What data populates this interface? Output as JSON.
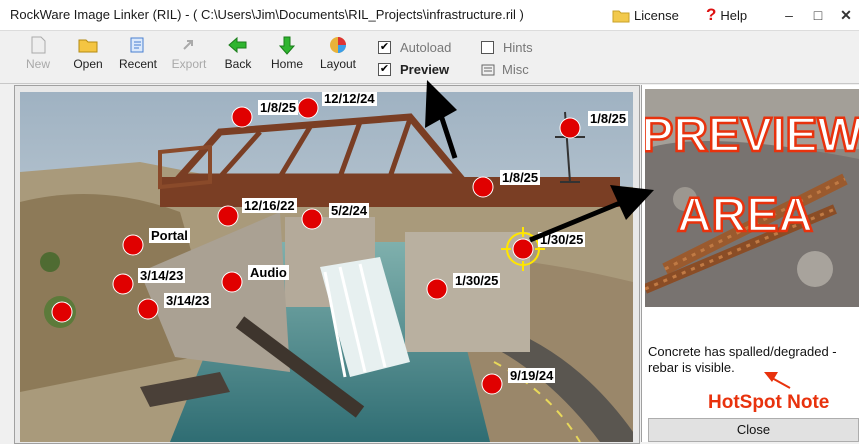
{
  "window": {
    "title": "RockWare Image Linker (RIL) - ( C:\\Users\\Jim\\Documents\\RIL_Projects\\infrastructure.ril )",
    "license_label": "License",
    "help_label": "Help",
    "minimize": "–",
    "maximize": "□",
    "close": "✕"
  },
  "toolbar": {
    "buttons": [
      {
        "label": "New",
        "icon": "new-icon",
        "enabled": false
      },
      {
        "label": "Open",
        "icon": "open-folder-icon",
        "enabled": true
      },
      {
        "label": "Recent",
        "icon": "recent-icon",
        "enabled": true
      },
      {
        "label": "Export",
        "icon": "export-icon",
        "enabled": false
      },
      {
        "label": "Back",
        "icon": "back-arrow-icon",
        "enabled": true
      },
      {
        "label": "Home",
        "icon": "home-arrow-icon",
        "enabled": true
      },
      {
        "label": "Layout",
        "icon": "layout-icon",
        "enabled": true
      }
    ],
    "autoload": {
      "label": "Autoload",
      "checked": true
    },
    "preview": {
      "label": "Preview",
      "checked": true
    },
    "hints": {
      "label": "Hints",
      "checked": false
    },
    "misc_label": "Misc"
  },
  "hotspots": [
    {
      "label": "1/8/25"
    },
    {
      "label": "12/12/24"
    },
    {
      "label": "1/8/25"
    },
    {
      "label": "1/8/25"
    },
    {
      "label": "12/16/22"
    },
    {
      "label": "5/2/24"
    },
    {
      "label": "Portal"
    },
    {
      "label": "1/30/25",
      "selected": true
    },
    {
      "label": "Audio"
    },
    {
      "label": "3/14/23"
    },
    {
      "label": "1/30/25"
    },
    {
      "label": "3/14/23"
    },
    {
      "label": ""
    },
    {
      "label": "9/19/24"
    }
  ],
  "preview": {
    "overlay_line1": "PREVIEW",
    "overlay_line2": "AREA",
    "note": "Concrete has spalled/degraded - rebar is visible.",
    "hotspot_note_label": "HotSpot Note",
    "close_label": "Close"
  },
  "colors": {
    "hotspot": "#e00000",
    "annotation_red": "#e8320d",
    "selected_ring": "#ffe600"
  }
}
